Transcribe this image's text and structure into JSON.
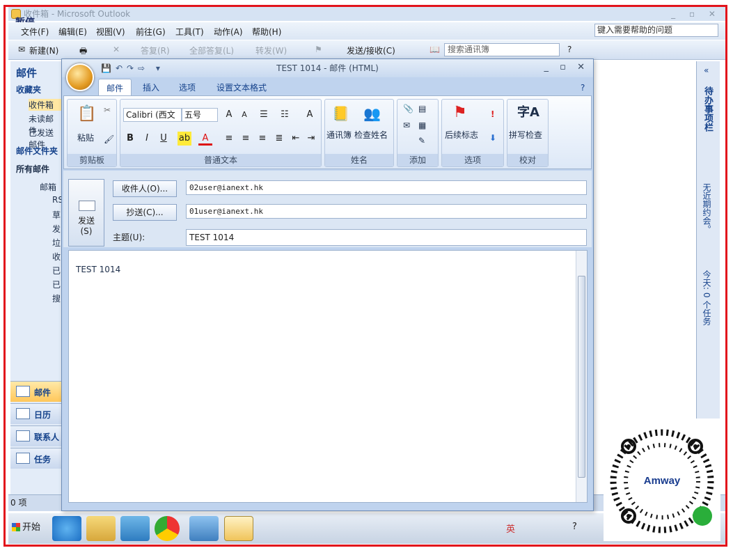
{
  "outlook": {
    "title": "收件箱 - Microsoft Outlook",
    "overlay_label": "暂停",
    "menu": [
      "文件(F)",
      "编辑(E)",
      "视图(V)",
      "前往(G)",
      "工具(T)",
      "动作(A)",
      "帮助(H)"
    ],
    "help_placeholder": "键入需要帮助的问题",
    "toolbar": {
      "new": "新建(N)",
      "reply": "答复(R)",
      "reply_all": "全部答复(L)",
      "forward": "转发(W)",
      "send_receive": "发送/接收(C)",
      "search_book": "搜索通讯簿"
    },
    "nav": {
      "title": "邮件",
      "favorites": "收藏夹",
      "fav_items": [
        "收件箱",
        "未读邮件",
        "已发送邮件"
      ],
      "folders_title": "邮件文件夹",
      "all_mail": "所有邮件",
      "mailbox": "邮箱",
      "sub_items": [
        "RS",
        "草",
        "发",
        "垃",
        "收",
        "已",
        "已",
        "搜"
      ],
      "buttons": [
        "邮件",
        "日历",
        "联系人",
        "任务"
      ]
    },
    "right_pane": {
      "todo": "待办事项栏",
      "no_appointments": "无近期约会。",
      "today": "今天: 0 个任务"
    },
    "status": "0 项"
  },
  "message": {
    "title": "TEST 1014 - 邮件 (HTML)",
    "tabs": [
      "邮件",
      "插入",
      "选项",
      "设置文本格式"
    ],
    "ribbon": {
      "paste": "粘贴",
      "clipboard": "剪贴板",
      "font_name": "Calibri (西文",
      "font_size": "五号",
      "basic_text": "普通文本",
      "address_book": "通讯簿",
      "check_names": "检查姓名",
      "names": "姓名",
      "include": "添加",
      "follow_up": "后续标志",
      "options": "选项",
      "spelling": "拼写检查",
      "proofing": "校对"
    },
    "send_label": "发送",
    "send_key": "(S)",
    "to_button": "收件人(O)...",
    "cc_button": "抄送(C)...",
    "subject_label": "主题(U):",
    "to_value": "02user@ianext.hk",
    "cc_value": "01user@ianext.hk",
    "subject_value": "TEST 1014",
    "body_text": "TEST 1014"
  },
  "taskbar": {
    "start": "开始",
    "ime": "英"
  },
  "qr": {
    "brand": "Amway"
  }
}
